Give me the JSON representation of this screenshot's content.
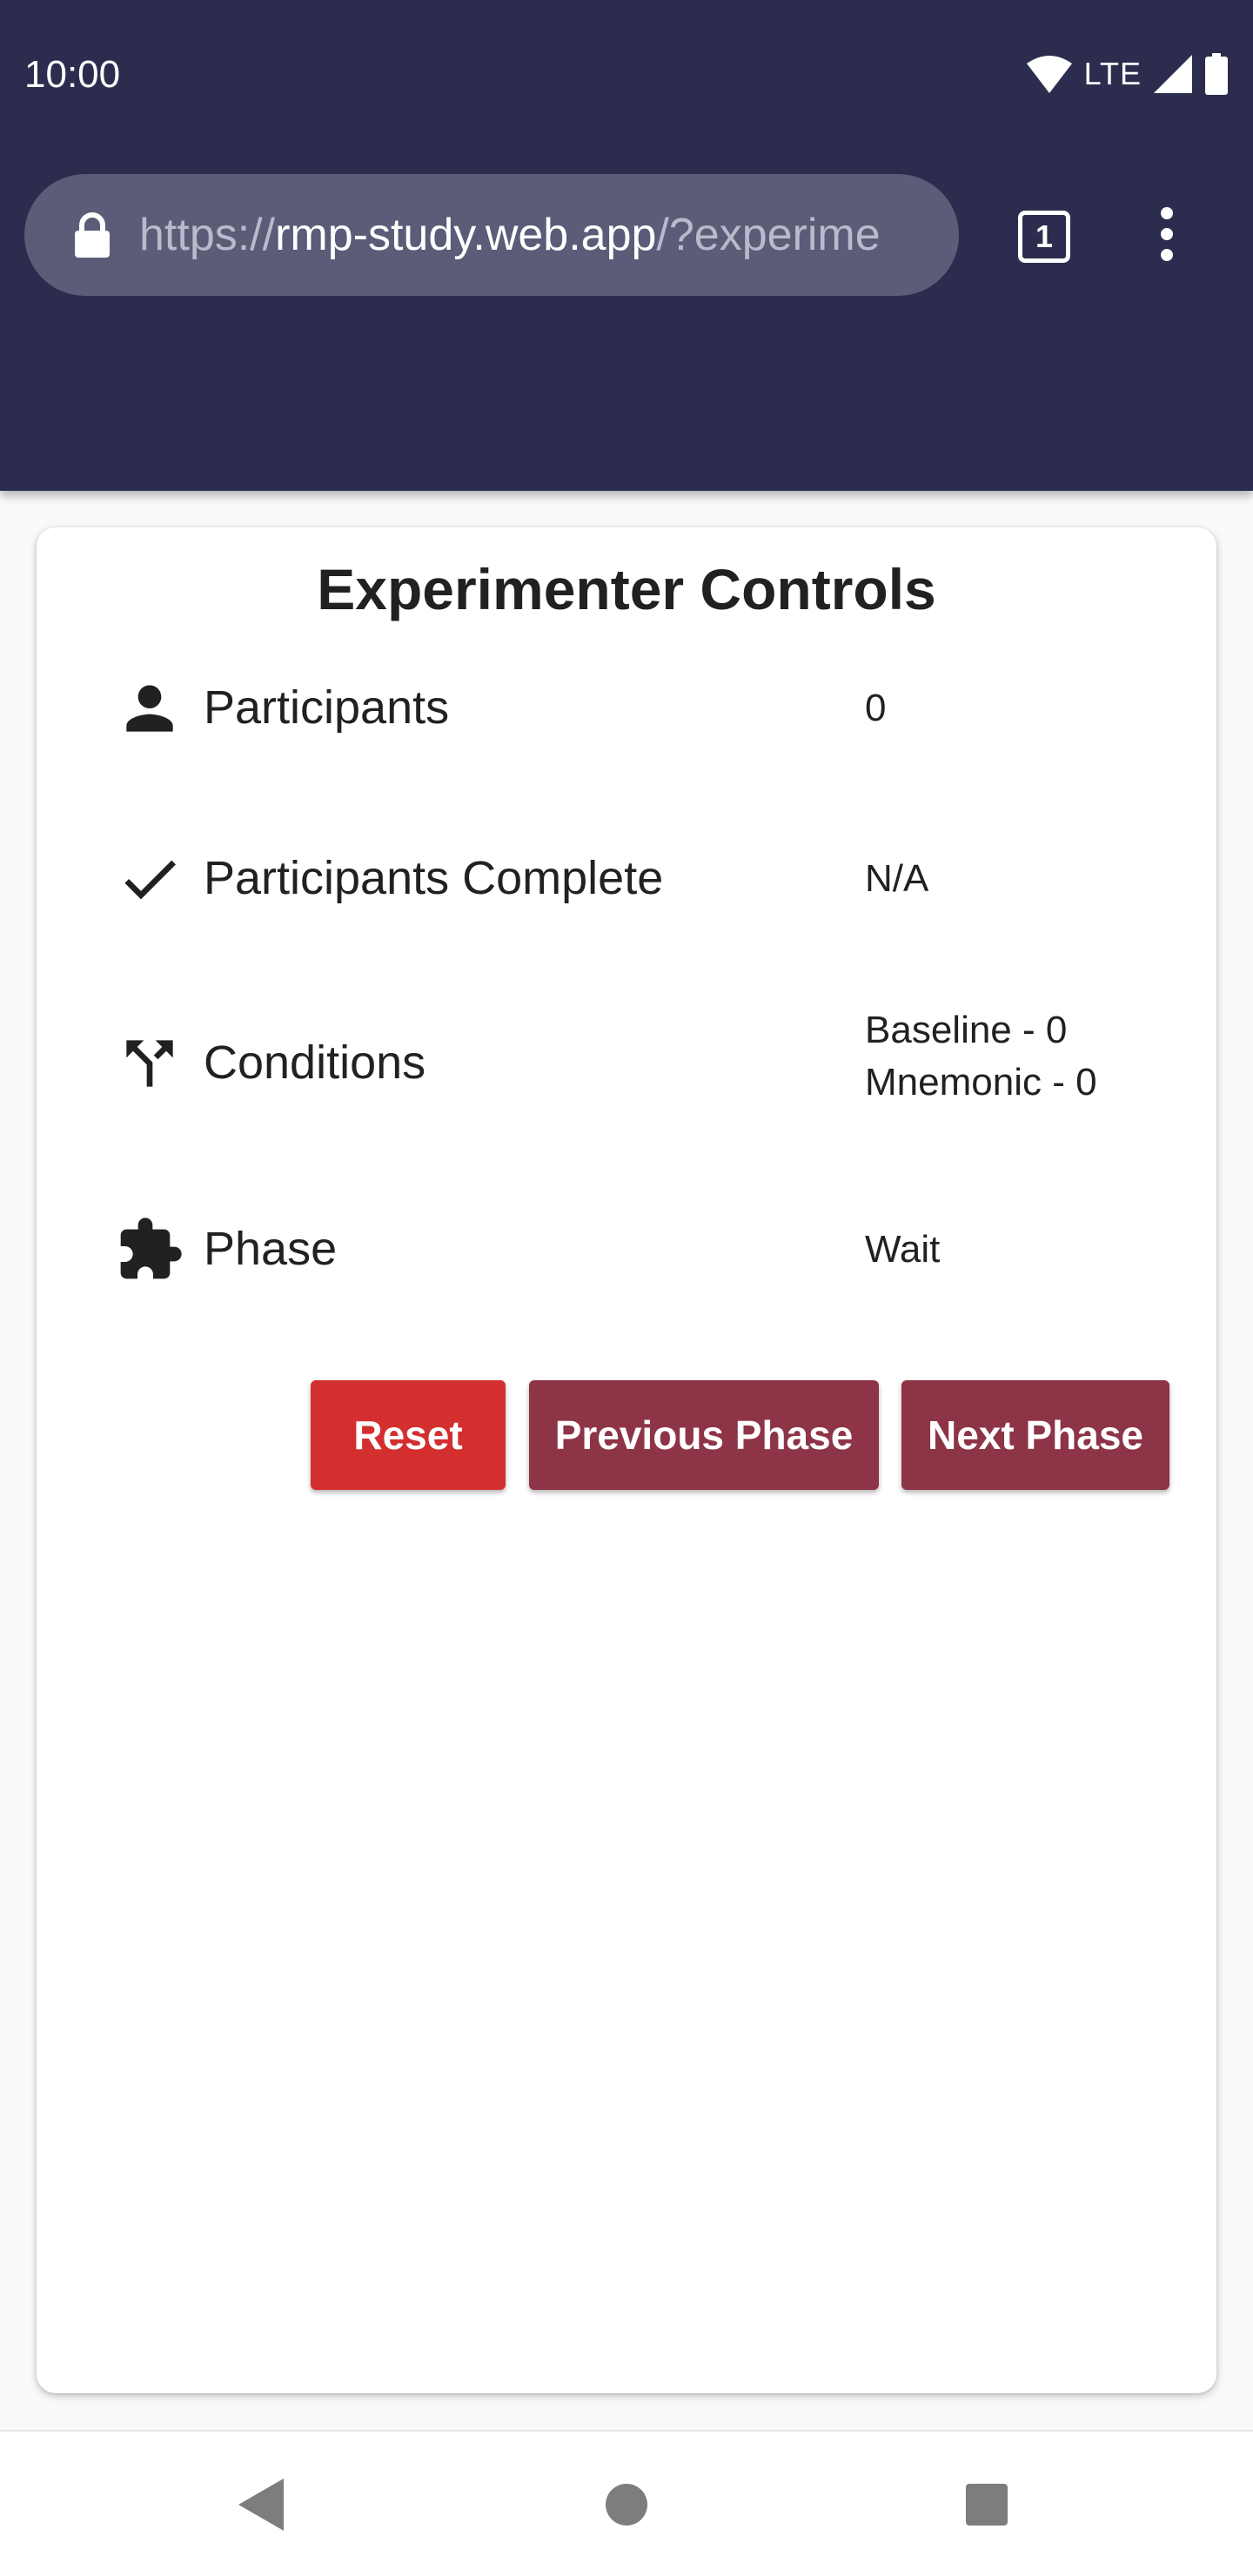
{
  "status_bar": {
    "time": "10:00",
    "network": "LTE"
  },
  "browser": {
    "url_scheme": "https://",
    "url_host": "rmp-study.web.app",
    "url_path": "/?experime",
    "tab_count": "1"
  },
  "card": {
    "title": "Experimenter Controls",
    "rows": [
      {
        "label": "Participants",
        "icon": "person-icon",
        "value": "0"
      },
      {
        "label": "Participants Complete",
        "icon": "check-icon",
        "value": "N/A"
      },
      {
        "label": "Conditions",
        "icon": "call-split-icon",
        "value_lines": [
          "Baseline - 0",
          "Mnemonic - 0"
        ]
      },
      {
        "label": "Phase",
        "icon": "puzzle-icon",
        "value": "Wait"
      }
    ],
    "buttons": {
      "reset": "Reset",
      "previous": "Previous Phase",
      "next": "Next Phase"
    }
  },
  "colors": {
    "toolbar": "#2c2d4e",
    "url_bar": "#5b5c77",
    "reset_button": "#d32f2f",
    "phase_buttons": "#8e3447"
  }
}
